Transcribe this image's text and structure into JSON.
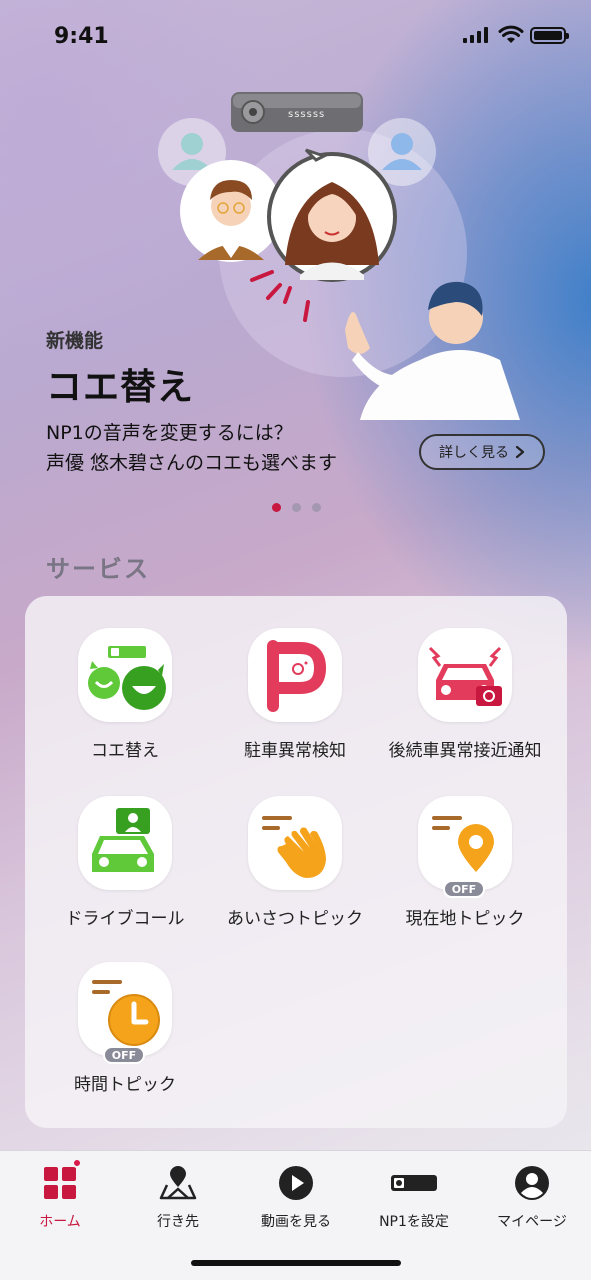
{
  "status_bar": {
    "time": "9:41"
  },
  "hero": {
    "kicker": "新機能",
    "title": "コエ替え",
    "desc_line1": "NP1の音声を変更するには？",
    "desc_line2": "声優 悠木碧さんのコエも選べます",
    "details_label": "詳しく見る",
    "device_label": "ssssss"
  },
  "carousel": {
    "active_index": 0,
    "count": 3
  },
  "services": {
    "section_title": "サービス",
    "items": [
      {
        "label": "コエ替え",
        "icon": "koe-kae-icon"
      },
      {
        "label": "駐車異常検知",
        "icon": "parking-alert-icon"
      },
      {
        "label": "後続車異常接近通知",
        "icon": "rear-car-alert-icon"
      },
      {
        "label": "ドライブコール",
        "icon": "drive-call-icon"
      },
      {
        "label": "あいさつトピック",
        "icon": "waving-hand-icon"
      },
      {
        "label": "現在地トピック",
        "icon": "location-pin-icon",
        "status": "OFF"
      },
      {
        "label": "時間トピック",
        "icon": "clock-icon",
        "status": "OFF"
      }
    ]
  },
  "tab_bar": {
    "tabs": [
      {
        "label": "ホーム",
        "icon": "home-grid-icon",
        "active": true
      },
      {
        "label": "行き先",
        "icon": "map-pin-icon"
      },
      {
        "label": "動画を見る",
        "icon": "play-icon"
      },
      {
        "label": "NP1を設定",
        "icon": "device-icon"
      },
      {
        "label": "マイページ",
        "icon": "profile-icon"
      }
    ]
  },
  "colors": {
    "accent": "#c8183f",
    "green": "#5fc93a",
    "orange": "#f5a31a",
    "brown": "#a86a2a"
  }
}
